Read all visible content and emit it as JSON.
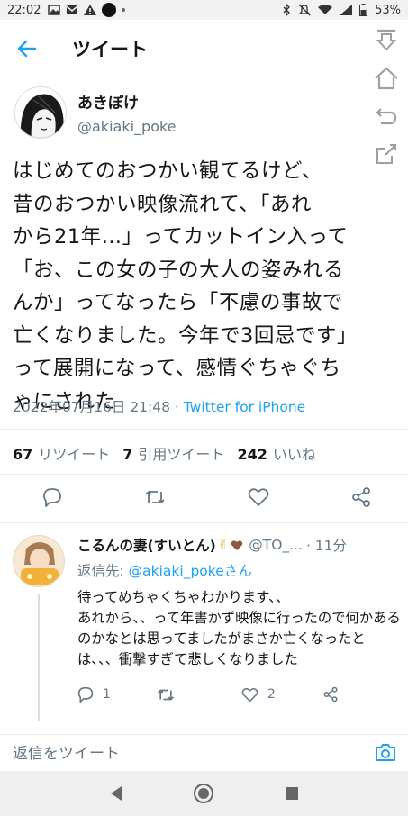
{
  "status_bar": {
    "time": "22:02",
    "battery": "53%"
  },
  "header": {
    "title": "ツイート"
  },
  "tweet": {
    "author_name": "あきぽけ",
    "author_handle": "@akiaki_poke",
    "text": "はじめてのおつかい観てるけど、\n昔のおつかい映像流れて、「あれ\nから21年…」ってカットイン入って\n「お、この女の子の大人の姿みれる\nんか」ってなったら「不慮の事故で\n亡くなりました。今年で3回忌です」\nって展開になって、感情ぐちゃぐち\nゃにされた",
    "datetime": "2022年07月16日 21:48",
    "separator": " · ",
    "source": "Twitter for iPhone",
    "retweets_count": "67",
    "retweets_label": "リツイート",
    "quotes_count": "7",
    "quotes_label": "引用ツイート",
    "likes_count": "242",
    "likes_label": "いいね"
  },
  "reply": {
    "name": "こるんの妻(すいとん)",
    "hand_emoji": "✌",
    "handle": "@TO_...",
    "time": " · 11分",
    "reply_to_label": "返信先: ",
    "reply_to_handle": "@akiaki_pokeさん",
    "text": "待ってめちゃくちゃわかります、、\nあれから、、って年書かず映像に行ったので何かあるのかなとは思ってましたがまさか亡くなったとは、、、衝撃すぎて悲しくなりました",
    "reply_count": "1",
    "like_count": "2"
  },
  "compose": {
    "placeholder": "返信をツイート"
  },
  "colors": {
    "accent": "#1da1f2",
    "secondary_text": "#657786",
    "divider": "#e6ecf0"
  }
}
